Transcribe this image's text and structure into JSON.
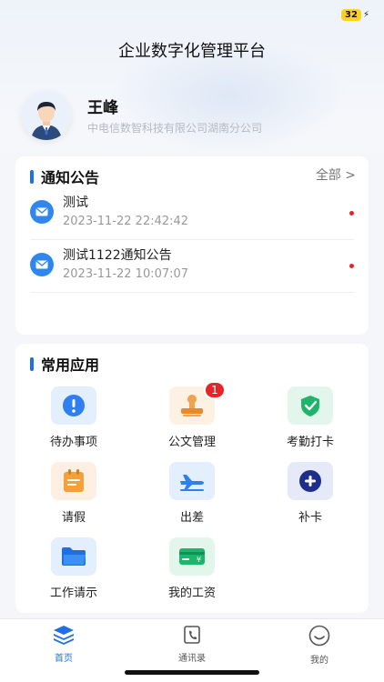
{
  "status": {
    "battery": "32"
  },
  "header": {
    "title": "企业数字化管理平台"
  },
  "user": {
    "name": "王峰",
    "company": "中电信数智科技有限公司湖南分公司"
  },
  "notice": {
    "title": "通知公告",
    "more": "全部 >",
    "items": [
      {
        "title": "测试",
        "time": "2023-11-22 22:42:42"
      },
      {
        "title": "测试1122通知公告",
        "time": "2023-11-22 10:07:07"
      }
    ]
  },
  "apps": {
    "title": "常用应用",
    "items": [
      {
        "label": "待办事项",
        "icon": "alert-icon"
      },
      {
        "label": "公文管理",
        "icon": "stamp-icon",
        "badge": "1"
      },
      {
        "label": "考勤打卡",
        "icon": "check-shield-icon"
      },
      {
        "label": "请假",
        "icon": "calendar-icon"
      },
      {
        "label": "出差",
        "icon": "airplane-icon"
      },
      {
        "label": "补卡",
        "icon": "plus-icon"
      },
      {
        "label": "工作请示",
        "icon": "folder-icon"
      },
      {
        "label": "我的工资",
        "icon": "wallet-icon"
      }
    ]
  },
  "tabs": [
    {
      "label": "首页",
      "active": true
    },
    {
      "label": "通讯录",
      "active": false
    },
    {
      "label": "我的",
      "active": false
    }
  ],
  "colors": {
    "accent": "#1f6fe5",
    "badge": "#e8242a"
  }
}
